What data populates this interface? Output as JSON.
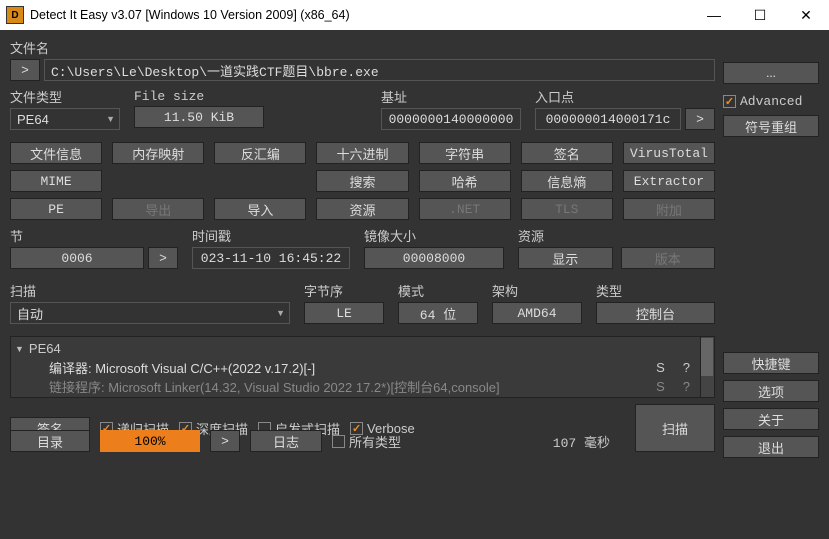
{
  "window": {
    "title": "Detect It Easy v3.07 [Windows 10 Version 2009] (x86_64)"
  },
  "filename_label": "文件名",
  "file_path": "C:\\Users\\Le\\Desktop\\一道实践CTF题目\\bbre.exe",
  "more_btn": "...",
  "advanced_label": "Advanced",
  "filetype": {
    "label": "文件类型",
    "value": "PE64"
  },
  "filesize": {
    "label": "File size",
    "value": "11.50 KiB"
  },
  "base": {
    "label": "基址",
    "value": "0000000140000000"
  },
  "entry": {
    "label": "入口点",
    "value": "000000014000171c",
    "go": ">"
  },
  "reorg_btn": "符号重组",
  "tool_rows": {
    "r1": [
      "文件信息",
      "内存映射",
      "反汇编",
      "十六进制",
      "字符串",
      "签名",
      "VirusTotal"
    ],
    "r2": [
      "MIME",
      "",
      "",
      "搜索",
      "哈希",
      "信息熵",
      "Extractor"
    ],
    "r3": [
      "PE",
      "导出",
      "导入",
      "资源",
      ".NET",
      "TLS",
      "附加"
    ]
  },
  "section": {
    "label": "节",
    "value": "0006",
    "go": ">"
  },
  "timestamp": {
    "label": "时间戳",
    "value": "023-11-10 16:45:22"
  },
  "imagesize": {
    "label": "镜像大小",
    "value": "00008000"
  },
  "resource": {
    "label": "资源",
    "show": "显示",
    "version": "版本"
  },
  "scan": {
    "label": "扫描",
    "value": "自动"
  },
  "endian": {
    "label": "字节序",
    "value": "LE"
  },
  "mode": {
    "label": "模式",
    "value": "64 位"
  },
  "arch": {
    "label": "架构",
    "value": "AMD64"
  },
  "type": {
    "label": "类型",
    "value": "控制台"
  },
  "tree": {
    "root": "PE64",
    "line1": "编译器: Microsoft Visual C/C++(2022 v.17.2)[-]",
    "line2": "链接程序: Microsoft Linker(14.32, Visual Studio 2022 17.2*)[控制台64,console]"
  },
  "opts": {
    "sig": "签名",
    "recursive": "递归扫描",
    "deep": "深度扫描",
    "heuristic": "启发式扫描",
    "verbose": "Verbose",
    "scan_btn": "扫描",
    "dir": "目录",
    "progress": "100%",
    "go": ">",
    "log": "日志",
    "alltypes": "所有类型",
    "elapsed": "107 毫秒"
  },
  "sidebar": {
    "shortcuts": "快捷键",
    "options": "选项",
    "about": "关于",
    "exit": "退出"
  }
}
